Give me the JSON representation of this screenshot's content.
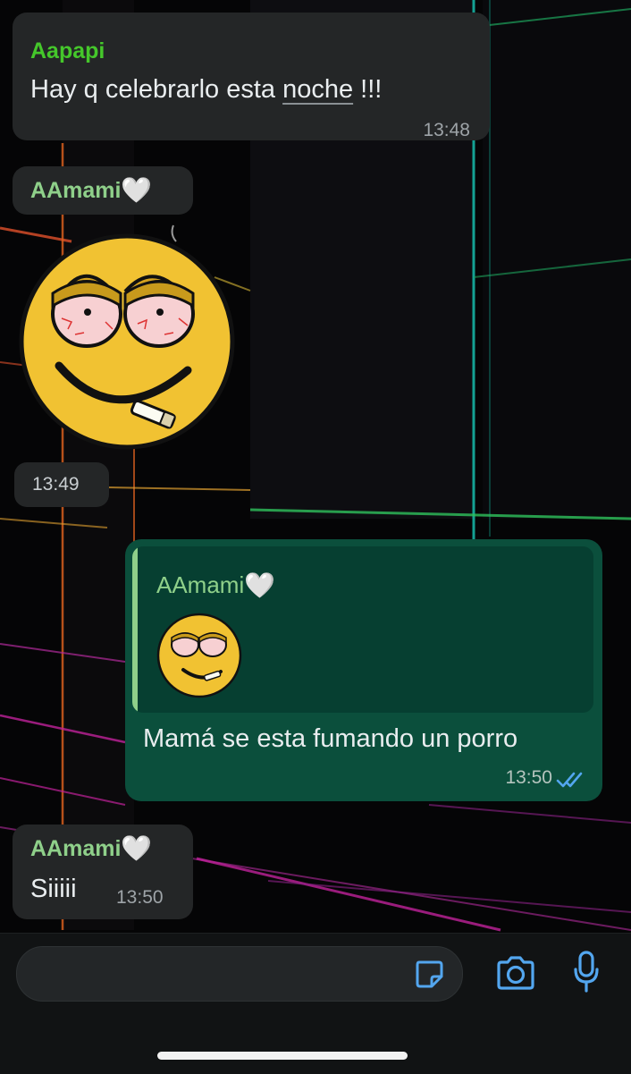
{
  "messages": {
    "m1": {
      "sender": "Aapapi",
      "text_before": "Hay q celebrarlo esta ",
      "text_underlined": "noche",
      "text_after": " !!!",
      "time": "13:48"
    },
    "m2": {
      "sender": "AAmami",
      "heart": "🤍",
      "sticker": "smoking-smiley-sticker",
      "time": "13:49"
    },
    "m3": {
      "reply_sender": "AAmami",
      "reply_heart": "🤍",
      "reply_thumb": "smoking-smiley-sticker",
      "text": "Mamá se esta fumando un porro",
      "time": "13:50",
      "status": "read-double-check"
    },
    "m4": {
      "sender": "AAmami",
      "heart": "🤍",
      "text": "Siiiii",
      "time": "13:50"
    }
  },
  "input": {
    "value": "",
    "placeholder": ""
  },
  "icons": {
    "sticker": "sticker-icon",
    "camera": "camera-icon",
    "mic": "microphone-icon"
  },
  "colors": {
    "incoming_bubble": "#242627",
    "outgoing_bubble": "#0b4f3c",
    "sender_aapapi": "#45c72b",
    "sender_aamami": "#8fd08a",
    "accent_icons": "#53a6ef",
    "read_ticks": "#53a6ef"
  }
}
